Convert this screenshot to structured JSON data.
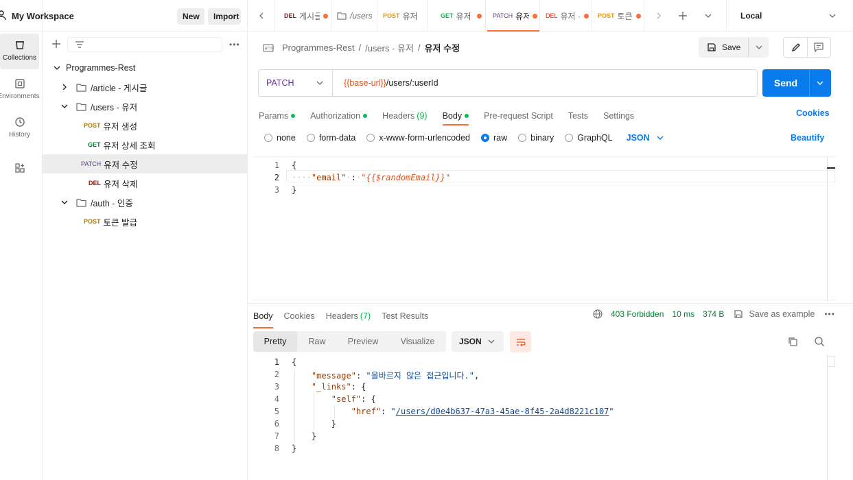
{
  "workspace": {
    "name": "My Workspace",
    "new_label": "New",
    "import_label": "Import"
  },
  "rail": [
    {
      "label": "Collections",
      "icon": "collections-icon"
    },
    {
      "label": "Environments",
      "icon": "environments-icon"
    },
    {
      "label": "History",
      "icon": "history-icon"
    },
    {
      "label": "",
      "icon": "apis-icon"
    }
  ],
  "sidebar": {
    "collection": "Programmes-Rest",
    "folders": [
      {
        "name": "/article - 게시글"
      },
      {
        "name": "/users - 유저"
      },
      {
        "name": "/auth - 인증"
      }
    ],
    "requests": [
      {
        "method": "POST",
        "name": "유저 생성"
      },
      {
        "method": "GET",
        "name": "유저 상세 조회"
      },
      {
        "method": "PATCH",
        "name": "유저 수정"
      },
      {
        "method": "DEL",
        "name": "유저 삭제"
      },
      {
        "method": "POST",
        "name": "토큰 발급"
      }
    ]
  },
  "tabs": [
    {
      "method": "DEL",
      "label": "게시글"
    },
    {
      "method": "",
      "label": "/users"
    },
    {
      "method": "POST",
      "label": "유저"
    },
    {
      "method": "GET",
      "label": "유저"
    },
    {
      "method": "PATCH",
      "label": "유저"
    },
    {
      "method": "DEL",
      "label": "유저 ·"
    },
    {
      "method": "POST",
      "label": "토큰"
    }
  ],
  "environment": "Local",
  "breadcrumb": {
    "collection": "Programmes-Rest",
    "folder": "/users - 유저",
    "request": "유저 수정"
  },
  "save_label": "Save",
  "request": {
    "method": "PATCH",
    "url_var": "{{base-url}}",
    "url_path": "/users/:userId",
    "send_label": "Send"
  },
  "request_tabs": [
    {
      "label": "Params",
      "indicator": "dot"
    },
    {
      "label": "Authorization",
      "indicator": "dot"
    },
    {
      "label": "Headers",
      "count": "(9)"
    },
    {
      "label": "Body",
      "indicator": "dot"
    },
    {
      "label": "Pre-request Script"
    },
    {
      "label": "Tests"
    },
    {
      "label": "Settings"
    }
  ],
  "cookies_label": "Cookies",
  "body_types": [
    "none",
    "form-data",
    "x-www-form-urlencoded",
    "raw",
    "binary",
    "GraphQL"
  ],
  "body_selected": "raw",
  "body_format": "JSON",
  "beautify_label": "Beautify",
  "request_body": {
    "line_numbers": [
      "1",
      "2",
      "3"
    ],
    "key": "\"email\"",
    "value": "\"{{$randomEmail}}\""
  },
  "response_tabs": [
    {
      "label": "Body"
    },
    {
      "label": "Cookies"
    },
    {
      "label": "Headers",
      "count": "(7)"
    },
    {
      "label": "Test Results"
    }
  ],
  "response_meta": {
    "status": "403 Forbidden",
    "time": "10 ms",
    "size": "374 B",
    "save_example": "Save as example"
  },
  "response_views": [
    "Pretty",
    "Raw",
    "Preview",
    "Visualize"
  ],
  "response_format": "JSON",
  "response_body": {
    "line_numbers": [
      "1",
      "2",
      "3",
      "4",
      "5",
      "6",
      "7",
      "8"
    ],
    "message_key": "\"message\"",
    "message_value": "\"올바르지 않은 접근입니다.\"",
    "links_key": "\"_links\"",
    "self_key": "\"self\"",
    "href_key": "\"href\"",
    "href_value": "/users/d0e4b637-47a3-45ae-8f45-2a4d8221c107"
  }
}
